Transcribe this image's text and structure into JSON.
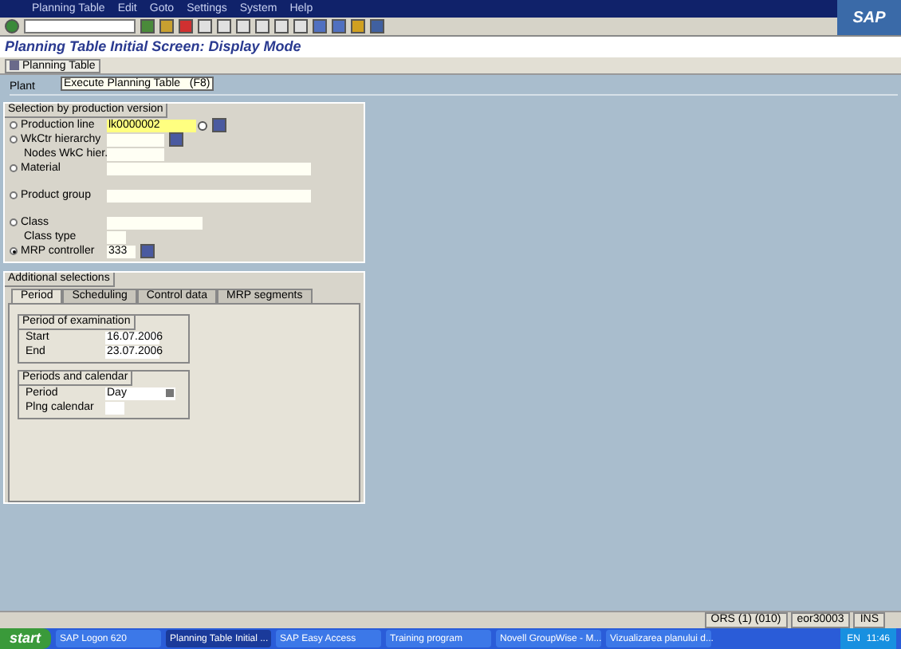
{
  "menu": [
    "Planning Table",
    "Edit",
    "Goto",
    "Settings",
    "System",
    "Help"
  ],
  "logo": "SAP",
  "screen_title": "Planning Table Initial Screen: Display Mode",
  "app_button": "Planning Table",
  "plant_label": "Plant",
  "tooltip": "Execute Planning Table   (F8)",
  "selection": {
    "title": "Selection by production version",
    "rows": [
      {
        "kind": "radio",
        "label": "Production line",
        "selected": false,
        "value": "lk0000002",
        "dropdown": true,
        "button": true
      },
      {
        "kind": "radio",
        "label": "WkCtr hierarchy",
        "selected": false,
        "button": true
      },
      {
        "kind": "plain",
        "label": "Nodes WkC hier."
      },
      {
        "kind": "radio",
        "label": "Material",
        "selected": false
      },
      {
        "kind": "radio",
        "label": "Product group",
        "selected": false
      },
      {
        "kind": "radio",
        "label": "Class",
        "selected": false
      },
      {
        "kind": "plain",
        "label": "Class type"
      },
      {
        "kind": "radio",
        "label": "MRP controller",
        "selected": true,
        "value": "333",
        "button": true
      }
    ]
  },
  "additional": {
    "title": "Additional selections",
    "tabs": [
      {
        "label": "Period",
        "selected": true
      },
      {
        "label": "Scheduling",
        "selected": false
      },
      {
        "label": "Control data",
        "selected": false
      },
      {
        "label": "MRP segments",
        "selected": false
      }
    ],
    "groups": [
      {
        "title": "Period of examination",
        "fields": [
          {
            "label": "Start",
            "value": "16.07.2006"
          },
          {
            "label": "End",
            "value": "23.07.2006"
          }
        ]
      },
      {
        "title": "Periods and calendar",
        "fields": [
          {
            "label": "Period",
            "value": "Day",
            "dropdown": true
          },
          {
            "label": "Plng calendar"
          }
        ]
      }
    ]
  },
  "status": [
    "ORS (1) (010)",
    "eor30003",
    "INS"
  ],
  "taskbar": {
    "start": "start",
    "items": [
      {
        "label": "SAP Logon 620",
        "selected": false
      },
      {
        "label": "Planning Table Initial ...",
        "selected": true
      },
      {
        "label": "SAP Easy Access",
        "selected": false
      },
      {
        "label": "Training program",
        "selected": false
      },
      {
        "label": "Novell GroupWise - M...",
        "selected": false
      },
      {
        "label": "Vizualizarea planului d...",
        "selected": false
      }
    ],
    "language": "EN",
    "clock": "11:46"
  }
}
